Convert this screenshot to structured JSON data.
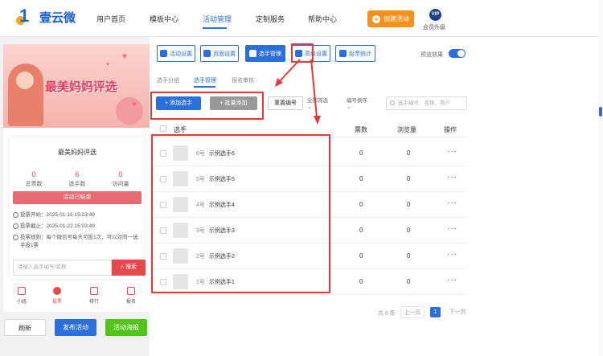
{
  "nav": {
    "brand": "壹云微",
    "items": [
      "用户首页",
      "模板中心",
      "活动管理",
      "定制服务",
      "帮助中心"
    ],
    "active_index": 2,
    "create_label": "创建活动",
    "vip_badge": "VIP",
    "vip_label": "会员升级"
  },
  "colors": {
    "accent": "#2a6fdb",
    "create": "#f7911b",
    "danger": "#e5484d",
    "annotation": "#e53935",
    "green": "#52c41a"
  },
  "preview": {
    "banner_title": "最美妈妈评选",
    "card_title": "最美妈妈评选",
    "stats": [
      {
        "value": "0",
        "label": "总票数"
      },
      {
        "value": "6",
        "label": "选手数"
      },
      {
        "value": "0",
        "label": "访问量"
      }
    ],
    "status": "活动已结束",
    "info": [
      "投票开始：2025-01-16 15:03:49",
      "投票截止：2025-01-22 15:03:49",
      "投票规则：每个微信号每天可投1次，可以对同一选手投1票"
    ],
    "search_placeholder": "请输入选手编号/名称",
    "search_label": "搜索",
    "tabs": [
      {
        "label": "小组",
        "icon": "group-icon"
      },
      {
        "label": "投票",
        "icon": "user-icon"
      },
      {
        "label": "排行",
        "icon": "rank-icon"
      },
      {
        "label": "报名",
        "icon": "signup-icon"
      }
    ],
    "active_tab": 1
  },
  "bottom_buttons": {
    "refresh": "刷新",
    "publish": "发布活动",
    "poster": "活动海报"
  },
  "toolbar": {
    "buttons": [
      "活动设置",
      "页面设置",
      "选手管理",
      "高级设置",
      "投票统计"
    ],
    "active_index": 2,
    "preview_label": "预览效果",
    "preview_on": true
  },
  "subtabs": [
    "选手分组",
    "选手管理",
    "报名审核"
  ],
  "active_subtab": 1,
  "actions": {
    "add": "+ 添加选手",
    "batch": "+ 批量添加",
    "renumber": "重置编号",
    "filter_all": "全部筛选",
    "sort": "编号倒序",
    "search_placeholder": "选手编号、名称、简介"
  },
  "table": {
    "headers": {
      "name": "选手",
      "votes": "票数",
      "views": "浏览量",
      "ops": "操作"
    },
    "rows": [
      {
        "no": "6号",
        "name": "示例选手6",
        "votes": "0",
        "views": "0"
      },
      {
        "no": "5号",
        "name": "示例选手5",
        "votes": "0",
        "views": "0"
      },
      {
        "no": "4号",
        "name": "示例选手4",
        "votes": "0",
        "views": "0"
      },
      {
        "no": "3号",
        "name": "示例选手3",
        "votes": "0",
        "views": "0"
      },
      {
        "no": "2号",
        "name": "示例选手2",
        "votes": "0",
        "views": "0"
      },
      {
        "no": "1号",
        "name": "示例选手1",
        "votes": "0",
        "views": "0"
      }
    ],
    "row_menu": "···"
  },
  "pagination": {
    "total": "共 6 条",
    "prev": "上一页",
    "current": "1",
    "next": "下一页"
  }
}
